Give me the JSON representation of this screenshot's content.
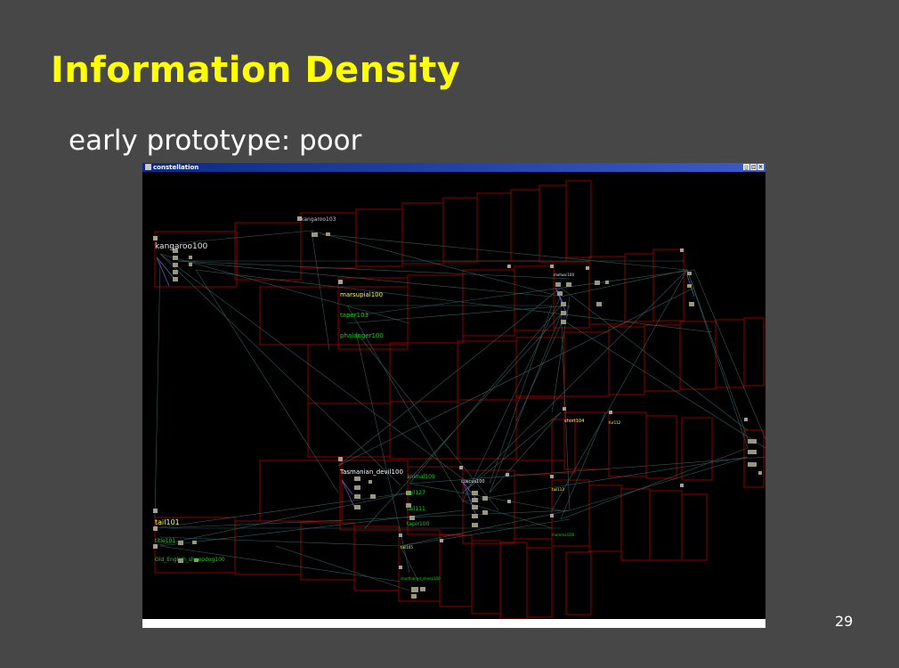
{
  "slide": {
    "title": "Information Density",
    "subtitle": "early prototype: poor",
    "page_number": "29"
  },
  "window": {
    "title": "constellation",
    "buttons": [
      "_",
      "□",
      "×"
    ]
  },
  "nodes": {
    "kangaroo100": "kangaroo100",
    "kangaroo103": "kangaroo103",
    "marsupial100": "marsupial100",
    "taper103": "taper103",
    "phalanger100": "phalanger100",
    "tasmanian_devil100": "Tasmanian_devil100",
    "animal109": "animal109",
    "tail127": "tail127",
    "tail111": "tail111",
    "tapir100": "tapir100",
    "cuscus100": "cuscus100",
    "tail101": "tail101",
    "tile101": "title101",
    "old_english_sheepdog100": "Old_English_sheepdog100",
    "short104": "short104",
    "fur112": "fur112",
    "mollusc100": "mollusc100",
    "mammal100": "mammal100",
    "tail105": "tail105",
    "tail113": "tail113",
    "shorthaired_sheep100": "shorthaired_sheep100"
  },
  "colors": {
    "background": "#474747",
    "title": "#ffff00",
    "subtitle": "#ffffff",
    "frame_stroke": "#8b0000",
    "edge": "#3d6b6b",
    "label_green": "#00e000",
    "label_yellow": "#ffff40",
    "label_white": "#e6e6e6",
    "bubble": "#9a9680"
  }
}
